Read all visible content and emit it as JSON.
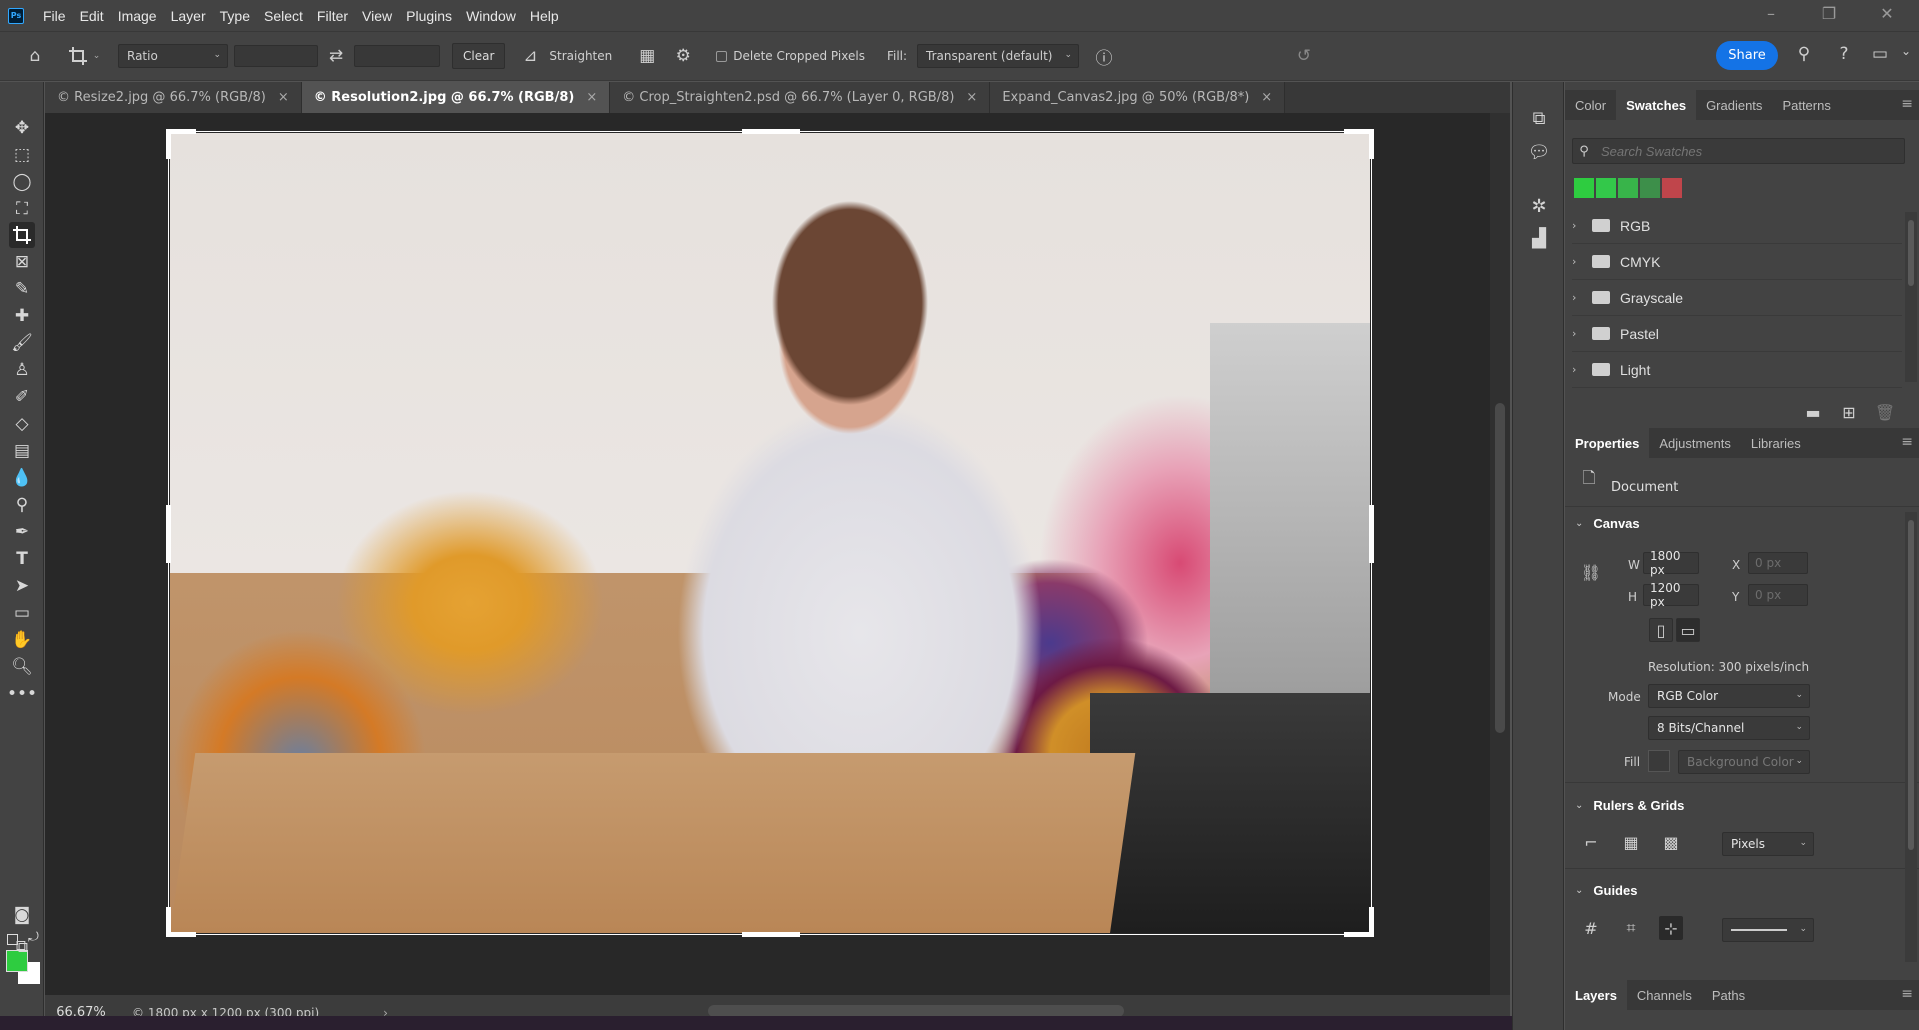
{
  "app": {
    "logo": "Ps"
  },
  "menu": [
    "File",
    "Edit",
    "Image",
    "Layer",
    "Type",
    "Select",
    "Filter",
    "View",
    "Plugins",
    "Window",
    "Help"
  ],
  "options": {
    "ratio": "Ratio",
    "clear": "Clear",
    "straighten": "Straighten",
    "delete_cropped": "Delete Cropped Pixels",
    "fill_label": "Fill:",
    "fill_value": "Transparent (default)",
    "share": "Share"
  },
  "tabs": [
    {
      "label": "© Resize2.jpg @ 66.7% (RGB/8)",
      "active": false
    },
    {
      "label": "© Resolution2.jpg @ 66.7% (RGB/8)",
      "active": true
    },
    {
      "label": "© Crop_Straighten2.psd @ 66.7% (Layer 0, RGB/8)",
      "active": false
    },
    {
      "label": "Expand_Canvas2.jpg @ 50% (RGB/8*)",
      "active": false
    }
  ],
  "status": {
    "zoom": "66.67%",
    "info": "© 1800 px x 1200 px (300 ppi)"
  },
  "colors": {
    "foreground": "#2ecc40",
    "background": "#ffffff",
    "accent": "#1473e6"
  },
  "swatches_panel": {
    "tabs": [
      "Color",
      "Swatches",
      "Gradients",
      "Patterns"
    ],
    "active_tab": "Swatches",
    "search_placeholder": "Search Swatches",
    "recent": [
      "#2ecc40",
      "#33c84a",
      "#38b44a",
      "#3d8f4a",
      "#c0454b"
    ],
    "groups": [
      "RGB",
      "CMYK",
      "Grayscale",
      "Pastel",
      "Light"
    ]
  },
  "properties_panel": {
    "tabs": [
      "Properties",
      "Adjustments",
      "Libraries"
    ],
    "active_tab": "Properties",
    "doc_label": "Document",
    "canvas_title": "Canvas",
    "w_label": "W",
    "w_value": "1800 px",
    "h_label": "H",
    "h_value": "1200 px",
    "x_label": "X",
    "x_placeholder": "0 px",
    "y_label": "Y",
    "y_placeholder": "0 px",
    "resolution": "Resolution: 300 pixels/inch",
    "mode_label": "Mode",
    "mode_value": "RGB Color",
    "bits_value": "8 Bits/Channel",
    "fill_label": "Fill",
    "fill_value": "Background Color",
    "rulers_title": "Rulers & Grids",
    "units": "Pixels",
    "guides_title": "Guides"
  },
  "layers_panel": {
    "tabs": [
      "Layers",
      "Channels",
      "Paths"
    ],
    "active_tab": "Layers"
  }
}
